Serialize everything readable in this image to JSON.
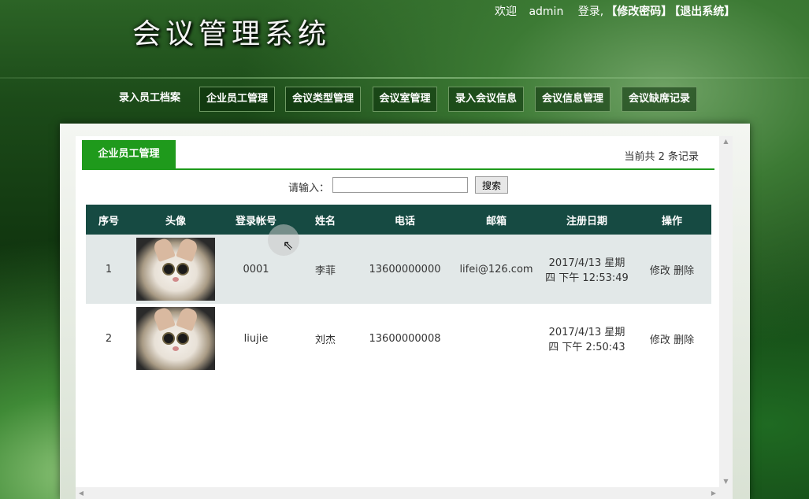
{
  "header": {
    "title": "会议管理系统",
    "welcome": "欢迎",
    "username": "admin",
    "logged_in": "登录,",
    "change_password": "【修改密码】",
    "logout": "【退出系统】"
  },
  "nav": {
    "items": [
      {
        "label": "录入员工档案"
      },
      {
        "label": "企业员工管理"
      },
      {
        "label": "会议类型管理"
      },
      {
        "label": "会议室管理"
      },
      {
        "label": "录入会议信息"
      },
      {
        "label": "会议信息管理"
      },
      {
        "label": "会议缺席记录"
      }
    ]
  },
  "panel": {
    "tab_label": "企业员工管理",
    "record_count": "当前共 2 条记录"
  },
  "search": {
    "label": "请输入：",
    "value": "",
    "button": "搜索"
  },
  "table": {
    "columns": [
      "序号",
      "头像",
      "登录帐号",
      "姓名",
      "电话",
      "邮箱",
      "注册日期",
      "操作"
    ],
    "rows": [
      {
        "index": "1",
        "avatar": "cat-photo",
        "account": "0001",
        "name": "李菲",
        "phone": "13600000000",
        "email": "lifei@126.com",
        "date_line1": "2017/4/13 星期",
        "date_line2": "四 下午 12:53:49",
        "edit": "修改",
        "delete": "删除"
      },
      {
        "index": "2",
        "avatar": "cat-photo",
        "account": "liujie",
        "name": "刘杰",
        "phone": "13600000008",
        "email": "",
        "date_line1": "2017/4/13 星期",
        "date_line2": "四 下午 2:50:43",
        "edit": "修改",
        "delete": "删除"
      }
    ]
  },
  "colors": {
    "tab_green": "#1f9a1c",
    "table_header": "#164a42",
    "row_alt": "#e2e8e8"
  }
}
